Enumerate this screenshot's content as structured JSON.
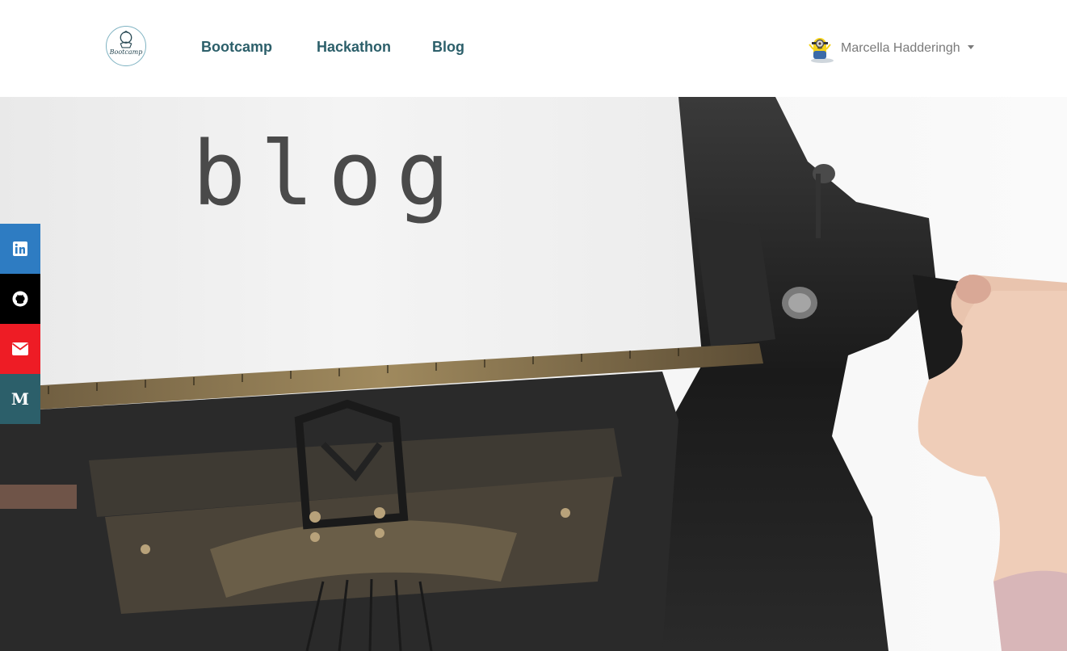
{
  "header": {
    "logo_text": "Bootcamp",
    "nav": [
      {
        "label": "Bootcamp"
      },
      {
        "label": "Hackathon"
      },
      {
        "label": "Blog"
      }
    ],
    "user": {
      "name": "Marcella Hadderingh"
    }
  },
  "hero": {
    "title": "blog"
  },
  "social": [
    {
      "icon": "linkedin-icon",
      "color": "#2e7cc2"
    },
    {
      "icon": "github-icon",
      "color": "#000000"
    },
    {
      "icon": "email-icon",
      "color": "#ee1c25"
    },
    {
      "icon": "medium-icon",
      "color": "#2c5f6a",
      "glyph": "M"
    }
  ],
  "colors": {
    "nav_text": "#2c5f6a",
    "user_text": "#7a7a7a"
  }
}
